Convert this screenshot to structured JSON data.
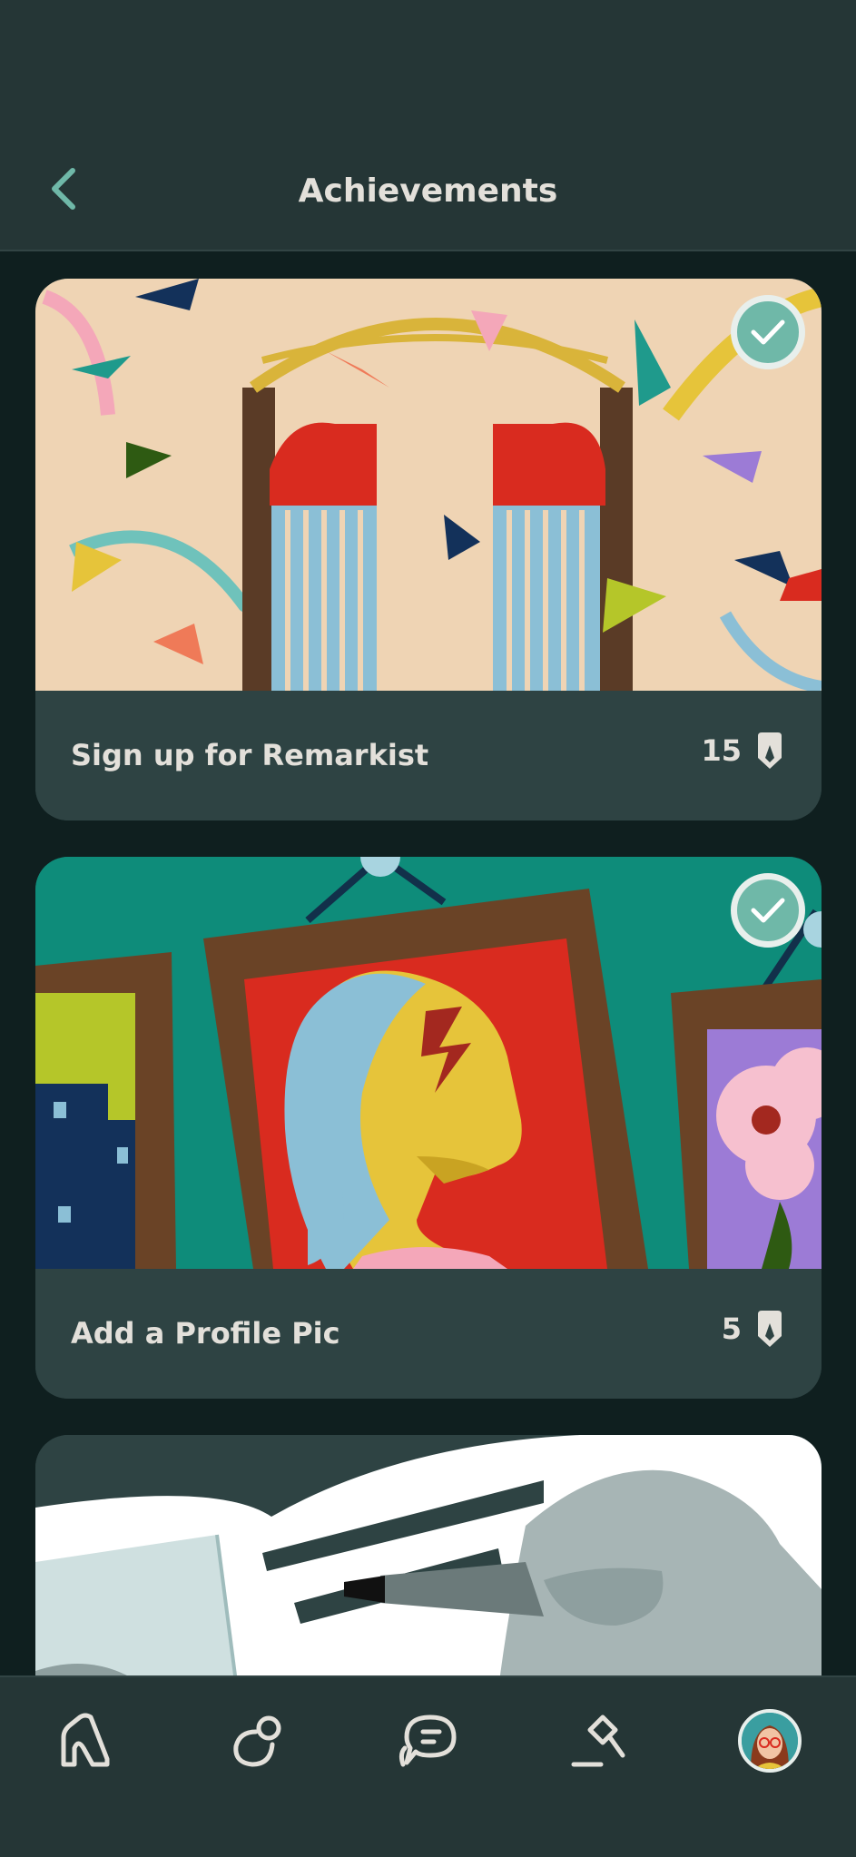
{
  "header": {
    "title": "Achievements"
  },
  "achievements": [
    {
      "title": "Sign up for Remarkist",
      "points": "15",
      "completed": true,
      "art": "gate-confetti-illustration"
    },
    {
      "title": "Add a Profile Pic",
      "points": "5",
      "completed": true,
      "art": "portrait-gallery-illustration"
    },
    {
      "title": "",
      "points": "",
      "completed": false,
      "art": "hand-writing-illustration"
    }
  ],
  "nav": {
    "items": [
      "home",
      "explore",
      "messages",
      "auction",
      "profile"
    ]
  },
  "colors": {
    "background": "#0f1f1f",
    "header": "#253636",
    "card": "#2e4343",
    "accent": "#6fb8a8",
    "text": "#e3e0da"
  }
}
